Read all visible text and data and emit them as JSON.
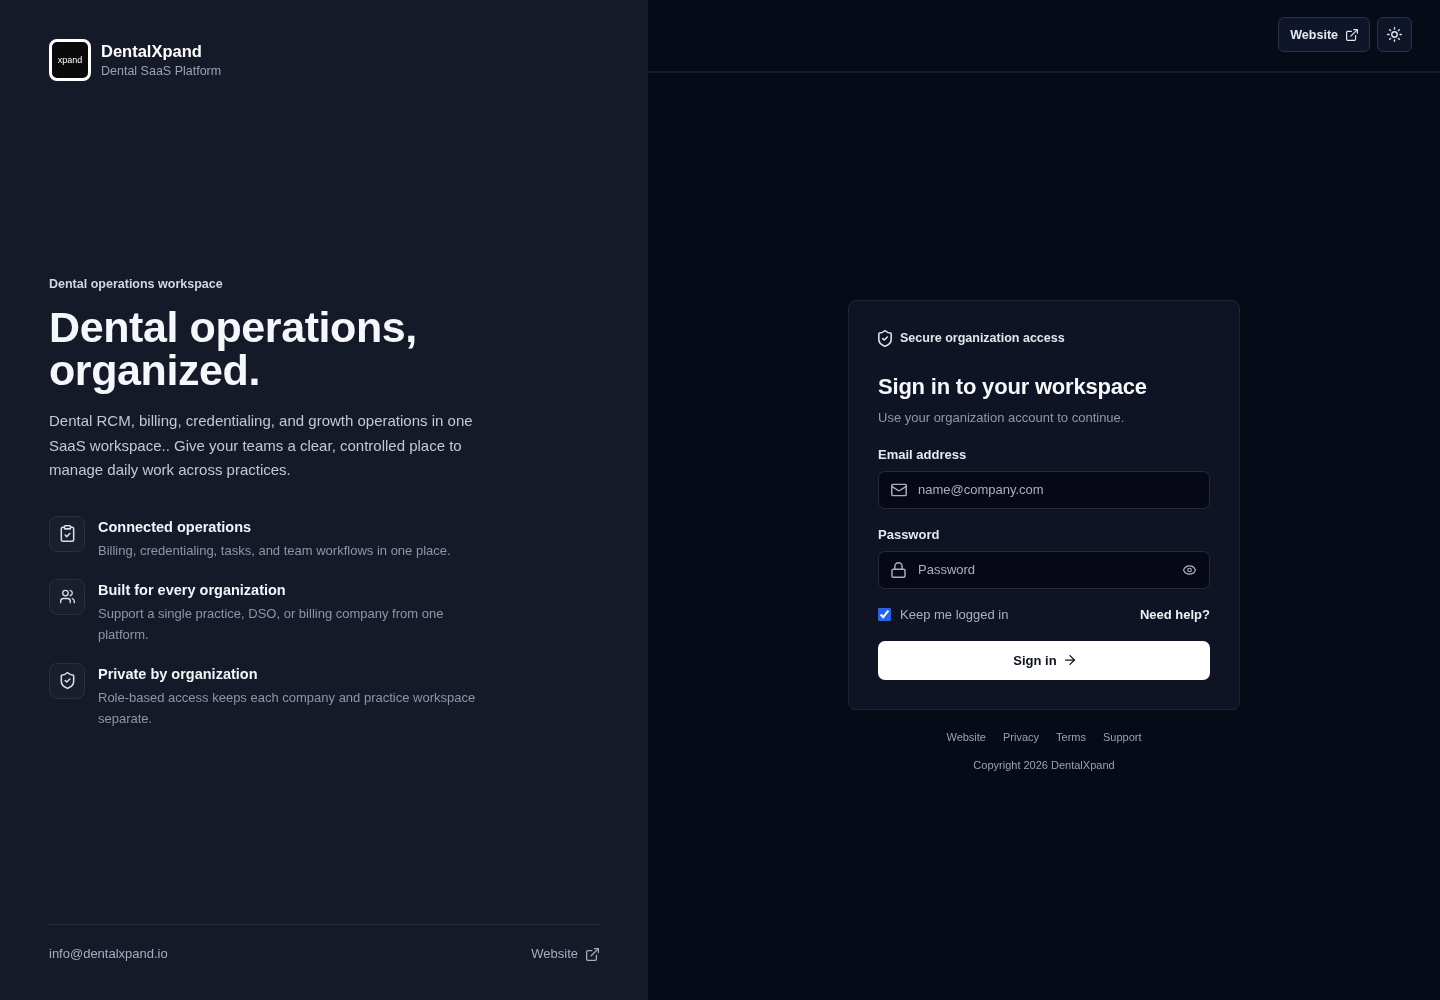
{
  "brand": {
    "logo_text": "xpand",
    "name": "DentalXpand",
    "tagline": "Dental SaaS Platform"
  },
  "hero": {
    "eyebrow": "Dental operations workspace",
    "headline": "Dental operations, organized.",
    "description": "Dental RCM, billing, credentialing, and growth operations in one SaaS workspace.. Give your teams a clear, controlled place to manage daily work across practices."
  },
  "features": [
    {
      "kind": "clipboard",
      "title": "Connected operations",
      "text": "Billing, credentialing, tasks, and team workflows in one place."
    },
    {
      "kind": "users",
      "title": "Built for every organization",
      "text": "Support a single practice, DSO, or billing company from one platform."
    },
    {
      "kind": "shield",
      "title": "Private by organization",
      "text": "Role-based access keeps each company and practice workspace separate."
    }
  ],
  "panel_footer": {
    "email": "info@dentalxpand.io",
    "website_link": "Website"
  },
  "top_bar": {
    "website_button": "Website"
  },
  "login": {
    "badge": "Secure organization access",
    "title": "Sign in to your workspace",
    "subtitle": "Use your organization account to continue.",
    "fields": [
      {
        "kind": "email",
        "label": "Email address",
        "placeholder": "name@company.com"
      },
      {
        "kind": "password",
        "label": "Password",
        "placeholder": "Password"
      }
    ],
    "remember": {
      "label": "Keep me logged in",
      "checked": true
    },
    "help_link": "Need help?",
    "submit": "Sign in"
  },
  "footer_links": [
    "Website",
    "Privacy",
    "Terms",
    "Support"
  ],
  "copyright": "Copyright 2026 DentalXpand"
}
